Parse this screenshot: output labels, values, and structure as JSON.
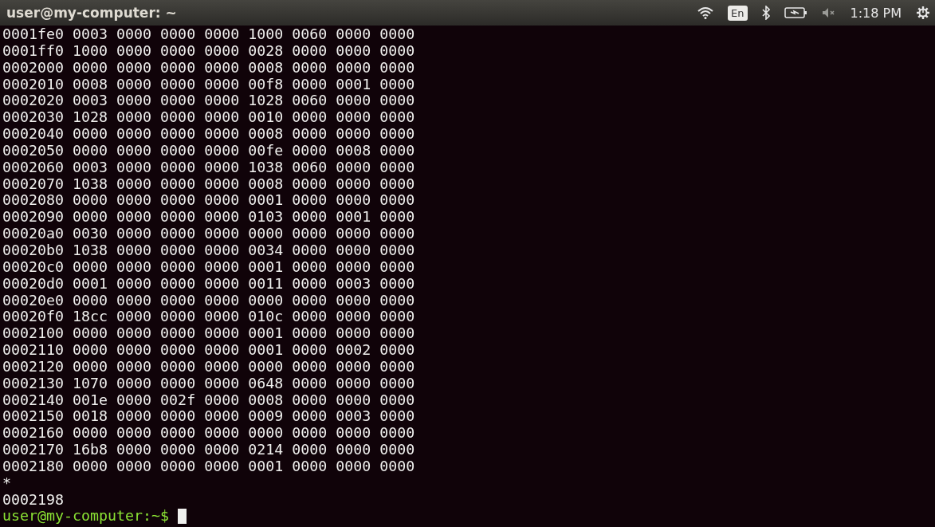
{
  "top_panel": {
    "title": "user@my-computer: ~",
    "keyboard_layout": "En",
    "volume_muted": true,
    "battery_charging": true,
    "time": "1:18 PM"
  },
  "terminal": {
    "lines": [
      "0001fe0 0003 0000 0000 0000 1000 0060 0000 0000",
      "0001ff0 1000 0000 0000 0000 0028 0000 0000 0000",
      "0002000 0000 0000 0000 0000 0008 0000 0000 0000",
      "0002010 0008 0000 0000 0000 00f8 0000 0001 0000",
      "0002020 0003 0000 0000 0000 1028 0060 0000 0000",
      "0002030 1028 0000 0000 0000 0010 0000 0000 0000",
      "0002040 0000 0000 0000 0000 0008 0000 0000 0000",
      "0002050 0000 0000 0000 0000 00fe 0000 0008 0000",
      "0002060 0003 0000 0000 0000 1038 0060 0000 0000",
      "0002070 1038 0000 0000 0000 0008 0000 0000 0000",
      "0002080 0000 0000 0000 0000 0001 0000 0000 0000",
      "0002090 0000 0000 0000 0000 0103 0000 0001 0000",
      "00020a0 0030 0000 0000 0000 0000 0000 0000 0000",
      "00020b0 1038 0000 0000 0000 0034 0000 0000 0000",
      "00020c0 0000 0000 0000 0000 0001 0000 0000 0000",
      "00020d0 0001 0000 0000 0000 0011 0000 0003 0000",
      "00020e0 0000 0000 0000 0000 0000 0000 0000 0000",
      "00020f0 18cc 0000 0000 0000 010c 0000 0000 0000",
      "0002100 0000 0000 0000 0000 0001 0000 0000 0000",
      "0002110 0000 0000 0000 0000 0001 0000 0002 0000",
      "0002120 0000 0000 0000 0000 0000 0000 0000 0000",
      "0002130 1070 0000 0000 0000 0648 0000 0000 0000",
      "0002140 001e 0000 002f 0000 0008 0000 0000 0000",
      "0002150 0018 0000 0000 0000 0009 0000 0003 0000",
      "0002160 0000 0000 0000 0000 0000 0000 0000 0000",
      "0002170 16b8 0000 0000 0000 0214 0000 0000 0000",
      "0002180 0000 0000 0000 0000 0001 0000 0000 0000",
      "*",
      "0002198"
    ],
    "prompt": "user@my-computer:~$"
  }
}
